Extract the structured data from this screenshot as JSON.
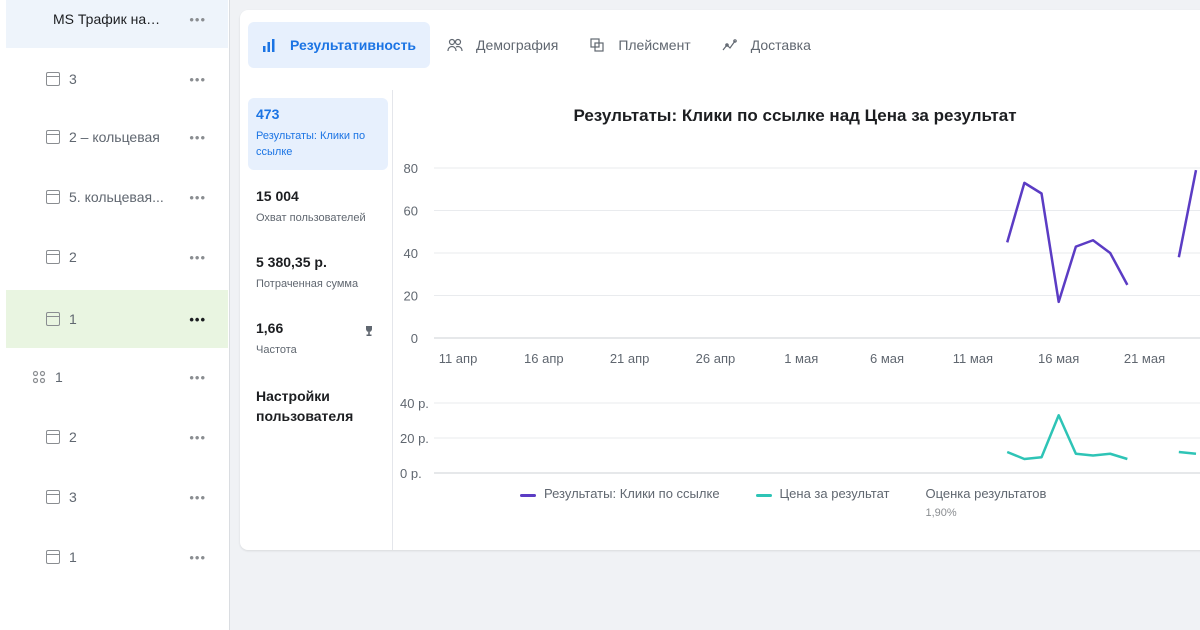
{
  "sidebar": {
    "campaign": {
      "label": "MS Трафик на к..."
    },
    "items": [
      {
        "label": "3",
        "type": "ad"
      },
      {
        "label": "2 – кольцевая",
        "type": "ad"
      },
      {
        "label": "5. кольцевая...",
        "type": "ad"
      },
      {
        "label": "2",
        "type": "ad"
      },
      {
        "label": "1",
        "type": "ad",
        "active": true
      },
      {
        "label": "1",
        "type": "adset"
      },
      {
        "label": "2",
        "type": "ad"
      },
      {
        "label": "3",
        "type": "ad"
      },
      {
        "label": "1",
        "type": "ad"
      }
    ],
    "more": "•••"
  },
  "tabs": [
    {
      "label": "Результативность",
      "icon": "bar-chart-icon",
      "active": true
    },
    {
      "label": "Демография",
      "icon": "people-icon"
    },
    {
      "label": "Плейсмент",
      "icon": "placement-icon"
    },
    {
      "label": "Доставка",
      "icon": "delivery-icon"
    }
  ],
  "metrics": [
    {
      "value": "473",
      "name": "Результаты: Клики по ссылке",
      "active": true
    },
    {
      "value": "15 004",
      "name": "Охват пользователей"
    },
    {
      "value": "5 380,35 р.",
      "name": "Потраченная сумма"
    },
    {
      "value": "1,66",
      "name": "Частота",
      "icon": "trophy-icon"
    }
  ],
  "user_settings": "Настройки пользователя",
  "chart_title": "Результаты: Клики по ссылке над Цена за результат",
  "colors": {
    "accent": "#1b74e4",
    "series1": "#5b3cc4",
    "series2": "#2ec4b6"
  },
  "legend": [
    {
      "label": "Результаты: Клики по ссылке",
      "color": "#5b3cc4"
    },
    {
      "label": "Цена за результат",
      "color": "#2ec4b6"
    },
    {
      "label": "Оценка результатов",
      "sub": "1,90%"
    }
  ],
  "chart_data": [
    {
      "type": "line",
      "series": [
        {
          "name": "Результаты: Клики по ссылке",
          "segments": [
            {
              "x": [
                "13 мая",
                "14 мая",
                "15 мая",
                "16 мая",
                "17 мая",
                "18 мая",
                "19 мая",
                "20 мая"
              ],
              "y": [
                45,
                73,
                68,
                17,
                43,
                46,
                40,
                25
              ]
            },
            {
              "x": [
                "23 мая",
                "24 мая"
              ],
              "y": [
                38,
                79
              ]
            }
          ]
        }
      ],
      "x_ticks": [
        "11 апр",
        "16 апр",
        "21 апр",
        "26 апр",
        "1 мая",
        "6 мая",
        "11 мая",
        "16 мая",
        "21 мая"
      ],
      "y_ticks": [
        "0",
        "20",
        "40",
        "60",
        "80"
      ],
      "ylim": [
        0,
        80
      ],
      "grid": true
    },
    {
      "type": "line",
      "series": [
        {
          "name": "Цена за результат",
          "segments": [
            {
              "x": [
                "13 мая",
                "14 мая",
                "15 мая",
                "16 мая",
                "17 мая",
                "18 мая",
                "19 мая",
                "20 мая"
              ],
              "y": [
                12,
                8,
                9,
                33,
                11,
                10,
                11,
                8
              ]
            },
            {
              "x": [
                "23 мая",
                "24 мая"
              ],
              "y": [
                12,
                11
              ]
            }
          ]
        }
      ],
      "y_ticks": [
        "0 р.",
        "20 р.",
        "40 р."
      ],
      "ylim": [
        0,
        40
      ],
      "grid": true
    }
  ]
}
